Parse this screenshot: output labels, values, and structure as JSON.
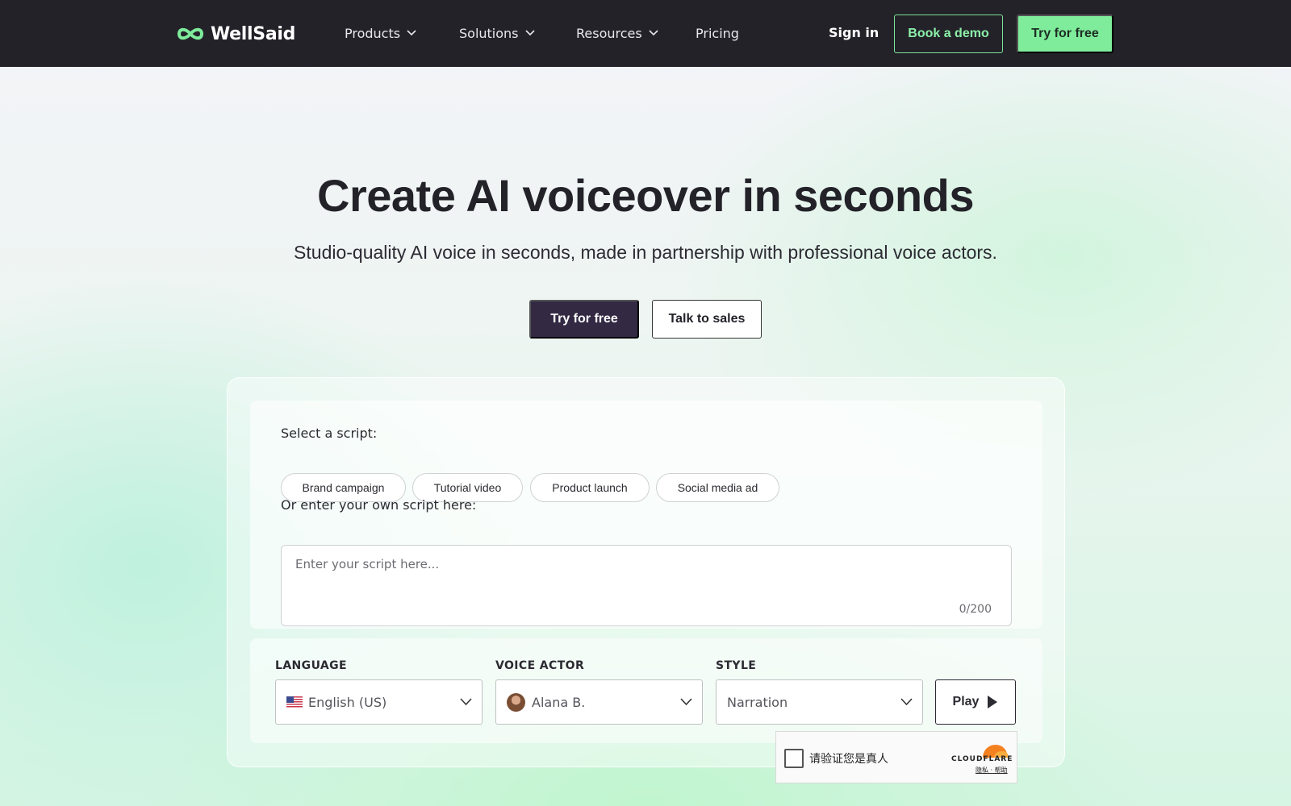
{
  "nav": {
    "brand": "WellSaid",
    "items": [
      {
        "label": "Products",
        "has_menu": true
      },
      {
        "label": "Solutions",
        "has_menu": true
      },
      {
        "label": "Resources",
        "has_menu": true
      },
      {
        "label": "Pricing",
        "has_menu": false
      }
    ],
    "sign_in": "Sign in",
    "book_demo": "Book a demo",
    "try_free": "Try for free"
  },
  "hero": {
    "title_light": "Create AI voiceover",
    "title_bold": "in seconds",
    "subtitle": "Studio-quality AI voice in seconds, made in partnership with professional voice actors.",
    "primary_cta": "Try for free",
    "secondary_cta": "Talk to sales"
  },
  "demo": {
    "select_script_label": "Select a script:",
    "scripts": [
      "Brand campaign",
      "Tutorial video",
      "Product launch",
      "Social media ad"
    ],
    "own_script_label": "Or enter your own script here:",
    "script_placeholder": "Enter your script here...",
    "char_count": "0/200",
    "language_label": "LANGUAGE",
    "language_value": "English (US)",
    "voice_label": "VOICE ACTOR",
    "voice_value": "Alana B.",
    "style_label": "STYLE",
    "style_value": "Narration",
    "play": "Play"
  },
  "captcha": {
    "text": "请验证您是真人",
    "brand": "CLOUDFLARE",
    "privacy": "隐私",
    "separator": "·",
    "help": "帮助"
  },
  "colors": {
    "nav_bg": "#232229",
    "accent_green": "#7eec9b",
    "primary_purple": "#332943"
  }
}
